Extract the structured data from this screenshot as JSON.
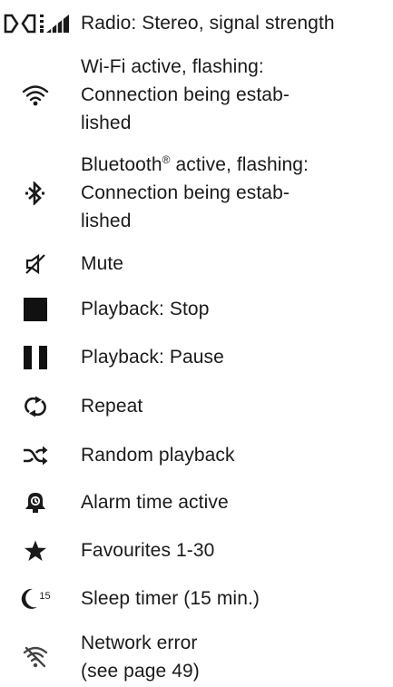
{
  "legend": [
    {
      "id": "radio-stereo",
      "icon": "stereo-signal-icon",
      "lines": [
        "Radio: Stereo, signal strength"
      ]
    },
    {
      "id": "wifi",
      "icon": "wifi-icon",
      "lines": [
        "Wi-Fi active, flashing:",
        "Connection being estab-",
        "lished"
      ]
    },
    {
      "id": "bluetooth",
      "icon": "bluetooth-icon",
      "lines": [
        "Bluetooth",
        "active, flashing:",
        "Connection being estab-",
        "lished"
      ]
    },
    {
      "id": "mute",
      "icon": "mute-icon",
      "lines": [
        "Mute"
      ]
    },
    {
      "id": "stop",
      "icon": "stop-icon",
      "lines": [
        "Playback: Stop"
      ]
    },
    {
      "id": "pause",
      "icon": "pause-icon",
      "lines": [
        "Playback: Pause"
      ]
    },
    {
      "id": "repeat",
      "icon": "repeat-icon",
      "lines": [
        "Repeat"
      ]
    },
    {
      "id": "random",
      "icon": "shuffle-icon",
      "lines": [
        "Random playback"
      ]
    },
    {
      "id": "alarm",
      "icon": "alarm-bell-icon",
      "lines": [
        "Alarm time active"
      ]
    },
    {
      "id": "favourites",
      "icon": "star-icon",
      "lines": [
        "Favourites 1-30"
      ]
    },
    {
      "id": "sleep",
      "icon": "sleep-timer-icon",
      "icon_text": "15",
      "lines": [
        "Sleep timer (15 min.)"
      ]
    },
    {
      "id": "network-error",
      "icon": "network-error-icon",
      "lines": [
        "Network error",
        "(see page 49)"
      ]
    }
  ],
  "registered_mark": "®"
}
